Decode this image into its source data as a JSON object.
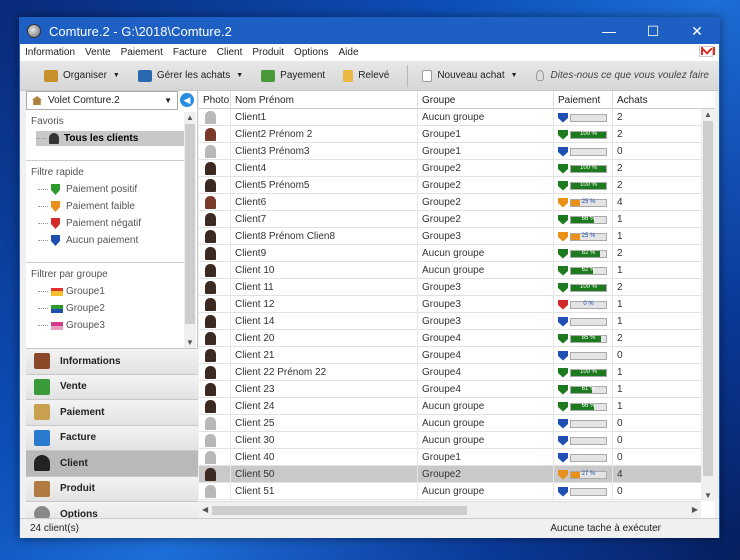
{
  "window": {
    "title": "Comture.2 - G:\\2018\\Comture.2",
    "minimize": "—",
    "maximize": "☐",
    "close": "✕"
  },
  "menu": [
    "Information",
    "Vente",
    "Paiement",
    "Facture",
    "Client",
    "Produit",
    "Options",
    "Aide"
  ],
  "toolbar": {
    "organiser": "Organiser",
    "gerer_achats": "Gérer les achats",
    "payement": "Payement",
    "releve": "Relevé",
    "nouveau_achat": "Nouveau achat",
    "hint": "Dites-nous ce que vous voulez faire"
  },
  "left_panel": {
    "volet": "Volet Comture.2",
    "favoris": "Favoris",
    "tous_clients": "Tous les clients",
    "filtre_rapide": "Filtre rapide",
    "quick_filters": [
      {
        "label": "Paiement positif",
        "color": "#2e9a2e"
      },
      {
        "label": "Paiement faible",
        "color": "#e8901a"
      },
      {
        "label": "Paiement négatif",
        "color": "#d22a2a"
      },
      {
        "label": "Aucun paiement",
        "color": "#1f4fb0"
      }
    ],
    "filtrer_groupe": "Filtrer par groupe",
    "groups": [
      {
        "label": "Groupe1",
        "color": "#e0302a"
      },
      {
        "label": "Groupe2",
        "color": "#2e9a2e"
      },
      {
        "label": "Groupe3",
        "color": "#d23a8a"
      }
    ]
  },
  "nav": [
    {
      "label": "Informations",
      "icon": "book-icon",
      "color": "#8a4a2a"
    },
    {
      "label": "Vente",
      "icon": "cart-icon",
      "color": "#3a9a3a"
    },
    {
      "label": "Paiement",
      "icon": "payment-icon",
      "color": "#c8a050"
    },
    {
      "label": "Facture",
      "icon": "invoice-icon",
      "color": "#2a7ad0"
    },
    {
      "label": "Client",
      "icon": "person-icon",
      "color": "#222222",
      "selected": true
    },
    {
      "label": "Produit",
      "icon": "box-icon",
      "color": "#b07a40"
    },
    {
      "label": "Options",
      "icon": "gear-icon",
      "color": "#888888"
    }
  ],
  "grid": {
    "columns": [
      "Photo",
      "Nom Prénom",
      "Groupe",
      "Paiement",
      "Achats"
    ],
    "rows": [
      {
        "name": "Client1",
        "group": "Aucun groupe",
        "pay": "none",
        "pct": 0,
        "achats": "2",
        "photo": "placeholder"
      },
      {
        "name": "Client2 Prénom 2",
        "group": "Groupe1",
        "pay": "positive",
        "pct": 100,
        "label": "100 %",
        "achats": "2",
        "photo": "woman"
      },
      {
        "name": "Client3 Prénom3",
        "group": "Groupe1",
        "pay": "none",
        "pct": 0,
        "achats": "0",
        "photo": "placeholder"
      },
      {
        "name": "Client4",
        "group": "Groupe2",
        "pay": "positive",
        "pct": 100,
        "label": "100 %",
        "achats": "2",
        "photo": "man"
      },
      {
        "name": "Client5 Prénom5",
        "group": "Groupe2",
        "pay": "positive",
        "pct": 100,
        "label": "100 %",
        "achats": "2",
        "photo": "man"
      },
      {
        "name": "Client6",
        "group": "Groupe2",
        "pay": "weak",
        "pct": 25,
        "label": "25 %",
        "achats": "4",
        "photo": "woman"
      },
      {
        "name": "Client7",
        "group": "Groupe2",
        "pay": "positive",
        "pct": 66,
        "label": "66 %",
        "achats": "1",
        "photo": "man"
      },
      {
        "name": "Client8 Prénom Clien8",
        "group": "Groupe3",
        "pay": "weak",
        "pct": 25,
        "label": "25 %",
        "achats": "1",
        "photo": "man"
      },
      {
        "name": "Client9",
        "group": "Aucun groupe",
        "pay": "positive",
        "pct": 82,
        "label": "82 %",
        "achats": "2",
        "photo": "man"
      },
      {
        "name": "Client 10",
        "group": "Aucun groupe",
        "pay": "positive",
        "pct": 62,
        "label": "62 %",
        "achats": "1",
        "photo": "man"
      },
      {
        "name": "Client 11",
        "group": "Groupe3",
        "pay": "positive",
        "pct": 100,
        "label": "100 %",
        "achats": "2",
        "photo": "man"
      },
      {
        "name": "Client 12",
        "group": "Groupe3",
        "pay": "negative",
        "pct": 0,
        "label": "0 %",
        "achats": "1",
        "photo": "man"
      },
      {
        "name": "Client 14",
        "group": "Groupe3",
        "pay": "none",
        "pct": 0,
        "achats": "1",
        "photo": "man"
      },
      {
        "name": "Client 20",
        "group": "Groupe4",
        "pay": "positive",
        "pct": 85,
        "label": "85 %",
        "achats": "2",
        "photo": "man"
      },
      {
        "name": "Client 21",
        "group": "Groupe4",
        "pay": "none",
        "pct": 0,
        "achats": "0",
        "photo": "man"
      },
      {
        "name": "Client 22 Prénom 22",
        "group": "Groupe4",
        "pay": "positive",
        "pct": 100,
        "label": "100 %",
        "achats": "1",
        "photo": "man"
      },
      {
        "name": "Client 23",
        "group": "Groupe4",
        "pay": "positive",
        "pct": 61,
        "label": "61 %",
        "achats": "1",
        "photo": "man"
      },
      {
        "name": "Client 24",
        "group": "Aucun groupe",
        "pay": "positive",
        "pct": 66,
        "label": "66 %",
        "achats": "1",
        "photo": "man"
      },
      {
        "name": "Client 25",
        "group": "Aucun groupe",
        "pay": "none",
        "pct": 0,
        "achats": "0",
        "photo": "placeholder"
      },
      {
        "name": "Client 30",
        "group": "Aucun groupe",
        "pay": "none",
        "pct": 0,
        "achats": "0",
        "photo": "placeholder"
      },
      {
        "name": "Client 40",
        "group": "Groupe1",
        "pay": "none",
        "pct": 0,
        "achats": "0",
        "photo": "placeholder"
      },
      {
        "name": "Client 50",
        "group": "Groupe2",
        "pay": "weak",
        "pct": 27,
        "label": "27 %",
        "achats": "4",
        "photo": "man",
        "selected": true
      },
      {
        "name": "Client 51",
        "group": "Aucun groupe",
        "pay": "none",
        "pct": 0,
        "achats": "0",
        "photo": "placeholder"
      }
    ]
  },
  "colors": {
    "positive": "#1e7a1e",
    "weak": "#e8901a",
    "negative": "#d22a2a",
    "none": "#1f4fb0"
  },
  "status": {
    "count": "24 client(s)",
    "task": "Aucune tache à exécuter"
  }
}
